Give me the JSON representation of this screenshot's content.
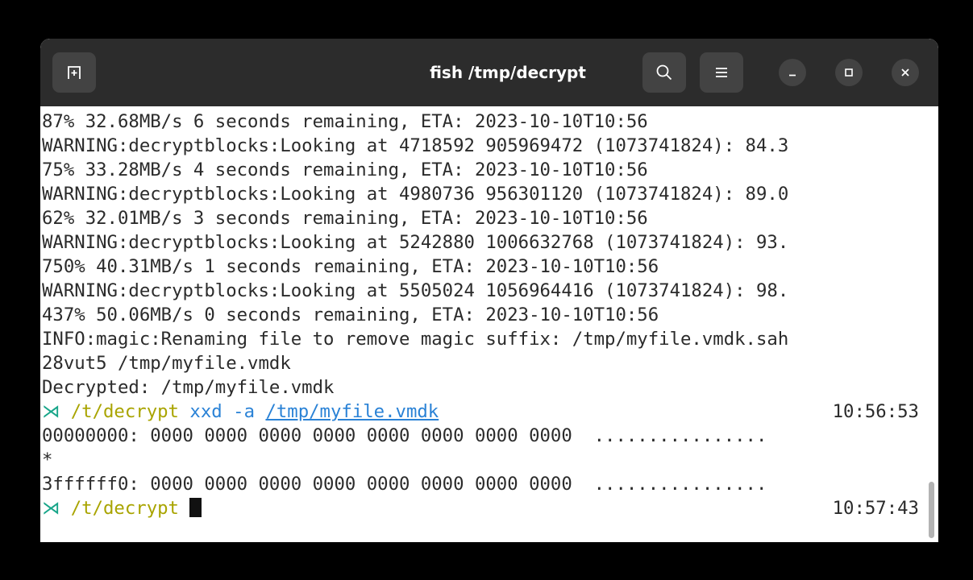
{
  "window": {
    "title": "fish /tmp/decrypt",
    "icons": {
      "new_tab": "new-tab-icon",
      "search": "search-icon",
      "menu": "hamburger-menu-icon",
      "minimize": "minimize-icon",
      "maximize": "maximize-icon",
      "close": "close-icon"
    }
  },
  "terminal": {
    "output_lines": [
      "87% 32.68MB/s 6 seconds remaining, ETA: 2023-10-10T10:56",
      "WARNING:decryptblocks:Looking at 4718592 905969472 (1073741824): 84.3",
      "75% 33.28MB/s 4 seconds remaining, ETA: 2023-10-10T10:56",
      "WARNING:decryptblocks:Looking at 4980736 956301120 (1073741824): 89.0",
      "62% 32.01MB/s 3 seconds remaining, ETA: 2023-10-10T10:56",
      "WARNING:decryptblocks:Looking at 5242880 1006632768 (1073741824): 93.",
      "750% 40.31MB/s 1 seconds remaining, ETA: 2023-10-10T10:56",
      "WARNING:decryptblocks:Looking at 5505024 1056964416 (1073741824): 98.",
      "437% 50.06MB/s 0 seconds remaining, ETA: 2023-10-10T10:56",
      "INFO:magic:Renaming file to remove magic suffix: /tmp/myfile.vmdk.sah",
      "28vut5 /tmp/myfile.vmdk",
      "Decrypted: /tmp/myfile.vmdk"
    ],
    "prompt1": {
      "symbol": "⋊",
      "cwd": "/t/decrypt",
      "command": "xxd",
      "flag": "-a",
      "argument": "/tmp/myfile.vmdk",
      "time": "10:56:53"
    },
    "xxd_lines": [
      "00000000: 0000 0000 0000 0000 0000 0000 0000 0000  ................",
      "*",
      "3ffffff0: 0000 0000 0000 0000 0000 0000 0000 0000  ................"
    ],
    "prompt2": {
      "symbol": "⋊",
      "cwd": "/t/decrypt",
      "time": "10:57:43"
    }
  },
  "colors": {
    "titlebar": "#2c2c2c",
    "button": "#434343",
    "terminal_bg": "#ffffff",
    "text": "#2b2b2b",
    "prompt_symbol": "#17a589",
    "cwd": "#a9a400",
    "command": "#2a82d6"
  }
}
